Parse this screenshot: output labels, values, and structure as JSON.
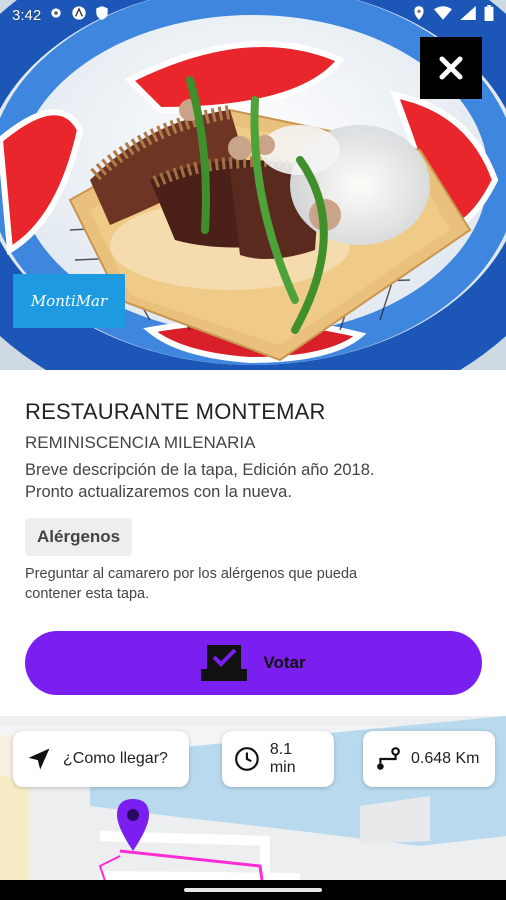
{
  "status_bar": {
    "time": "3:42"
  },
  "header": {
    "logo_text": "MontiMar"
  },
  "restaurant": {
    "name": "RESTAURANTE MONTEMAR",
    "tapa_name": "REMINISCENCIA MILENARIA",
    "description": "Breve descripción de la tapa, Edición año 2018.\nPronto actualizaremos con la nueva.",
    "allergens_label": "Alérgenos",
    "allergens_text": "Preguntar al camarero por los alérgenos que pueda\ncontener esta tapa."
  },
  "vote_button": {
    "label": "Votar"
  },
  "map_info": {
    "directions_label": "¿Como llegar?",
    "time_label": "8.1 min",
    "distance_label": "0.648 Km"
  },
  "colors": {
    "accent": "#7a1ff0",
    "logo_bg": "#1e9be0",
    "route": "#ff2bd6",
    "pin": "#7a1ff0"
  }
}
